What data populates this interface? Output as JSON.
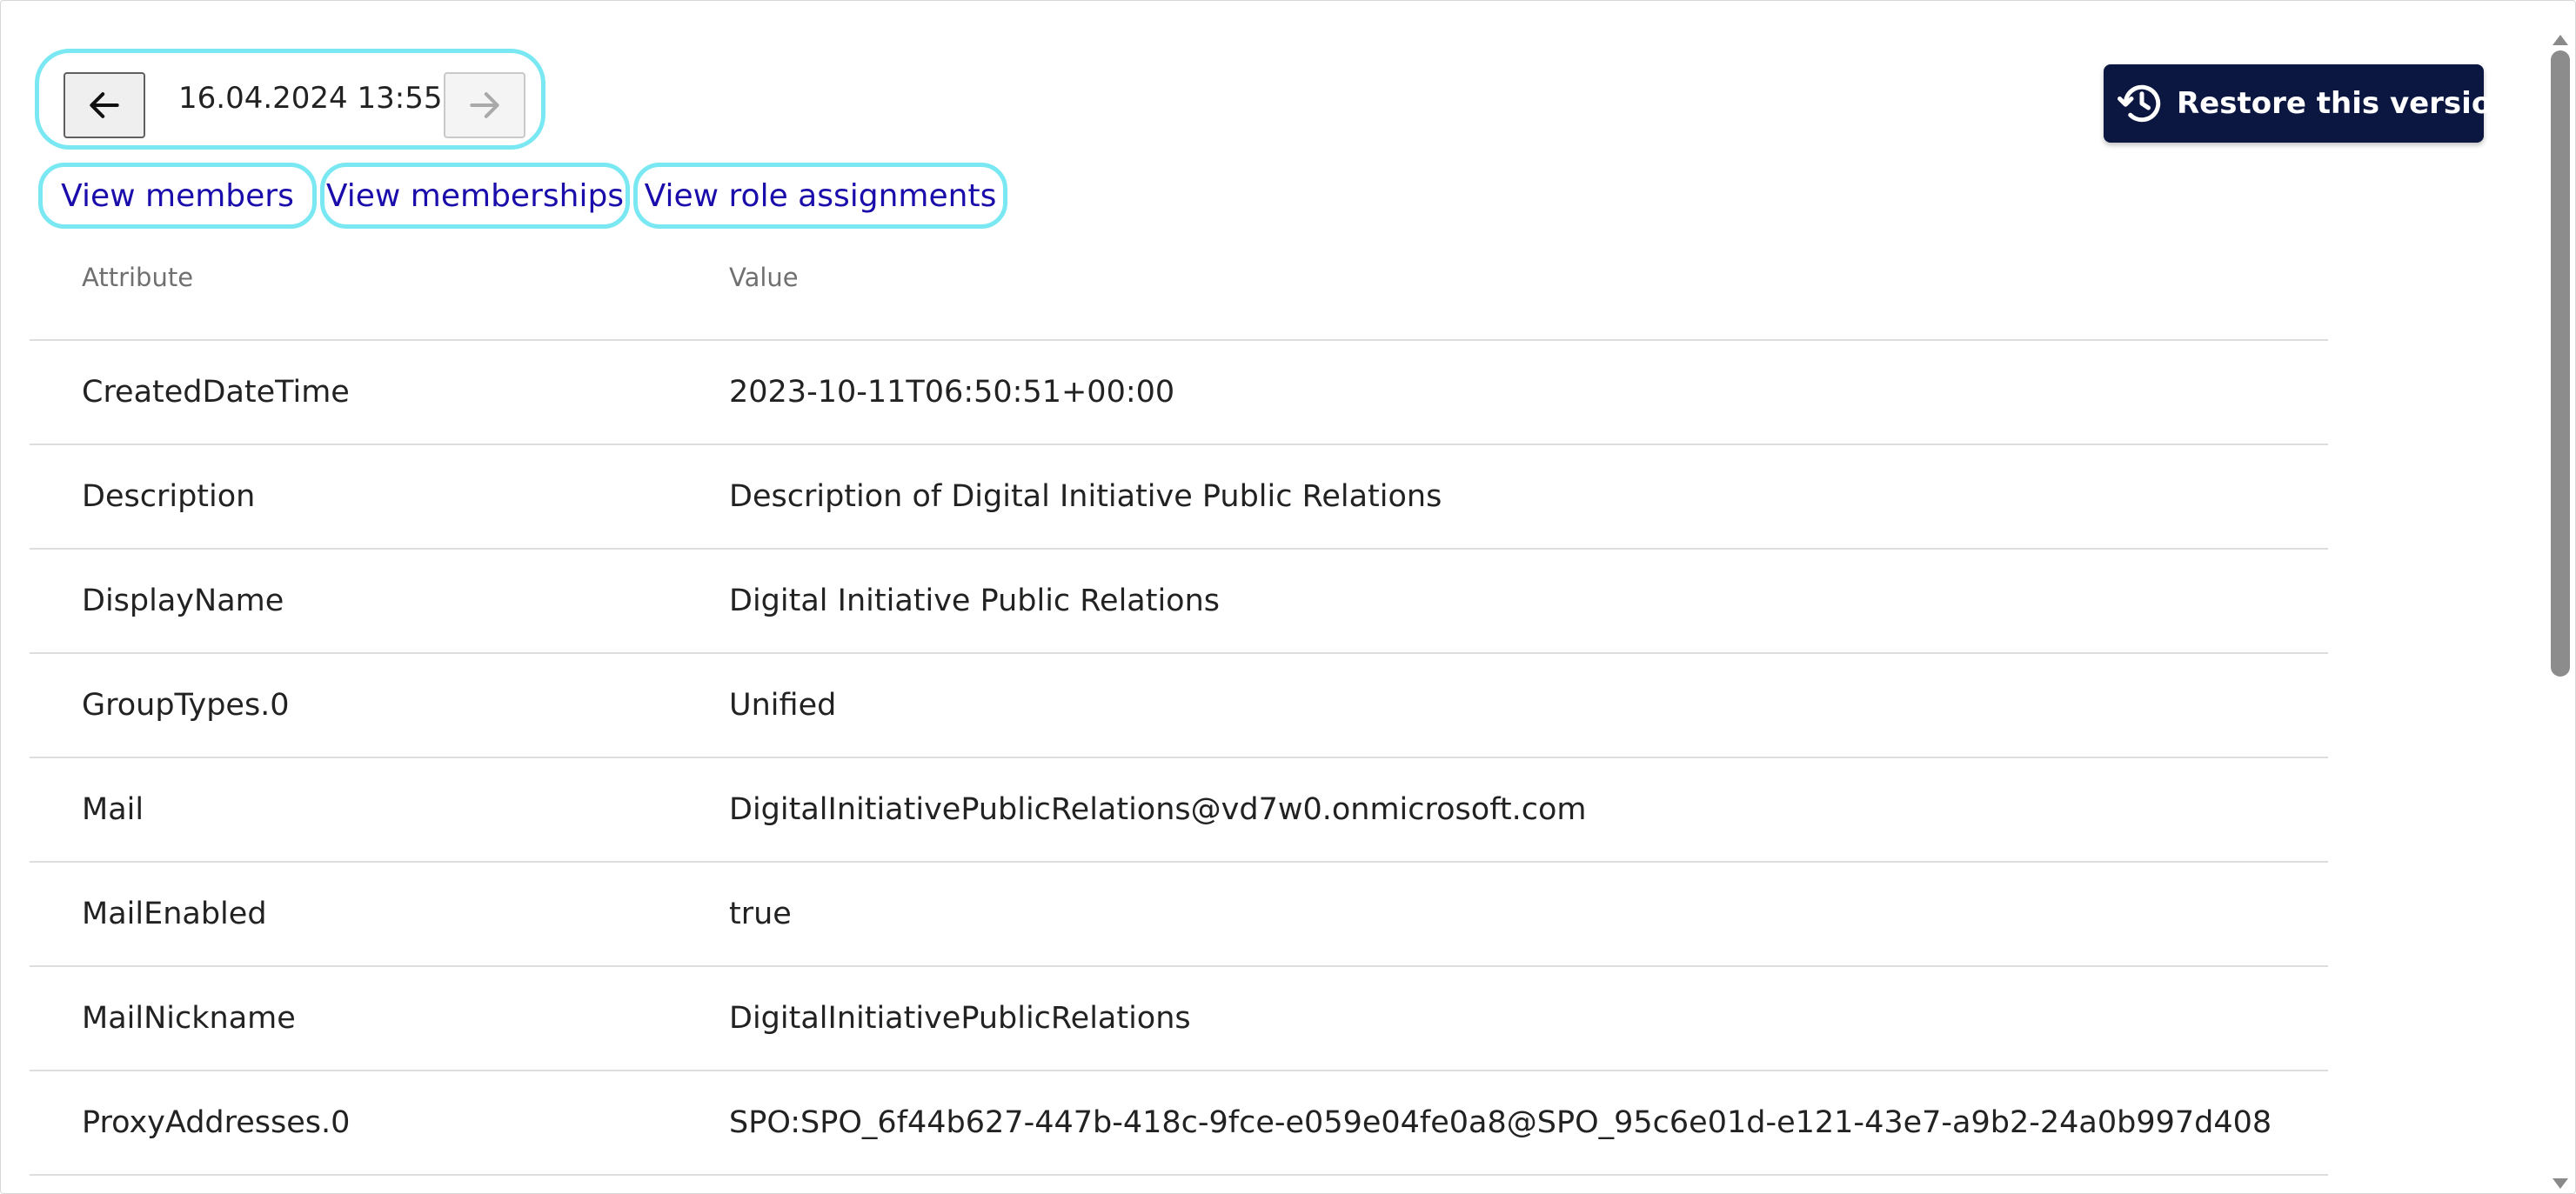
{
  "version_nav": {
    "date": "16.04.2024 13:55",
    "prev_icon": "arrow-left-icon",
    "next_icon": "arrow-right-icon"
  },
  "restore_button": {
    "label": "Restore this version",
    "icon": "history-restore-icon",
    "background": "#0b1740"
  },
  "links": {
    "members": "View members",
    "memberships": "View memberships",
    "role_assignments": "View role assignments",
    "color": "#1a0dab",
    "highlight": "#7ae8f2"
  },
  "table": {
    "headers": {
      "attribute": "Attribute",
      "value": "Value"
    },
    "rows": [
      {
        "attribute": "CreatedDateTime",
        "value": "2023-10-11T06:50:51+00:00"
      },
      {
        "attribute": "Description",
        "value": "Description of Digital Initiative Public Relations"
      },
      {
        "attribute": "DisplayName",
        "value": "Digital Initiative Public Relations"
      },
      {
        "attribute": "GroupTypes.0",
        "value": "Unified"
      },
      {
        "attribute": "Mail",
        "value": "DigitalInitiativePublicRelations@vd7w0.onmicrosoft.com"
      },
      {
        "attribute": "MailEnabled",
        "value": "true"
      },
      {
        "attribute": "MailNickname",
        "value": "DigitalInitiativePublicRelations"
      },
      {
        "attribute": "ProxyAddresses.0",
        "value": "SPO:SPO_6f44b627-447b-418c-9fce-e059e04fe0a8@SPO_95c6e01d-e121-43e7-a9b2-24a0b997d408"
      }
    ]
  }
}
